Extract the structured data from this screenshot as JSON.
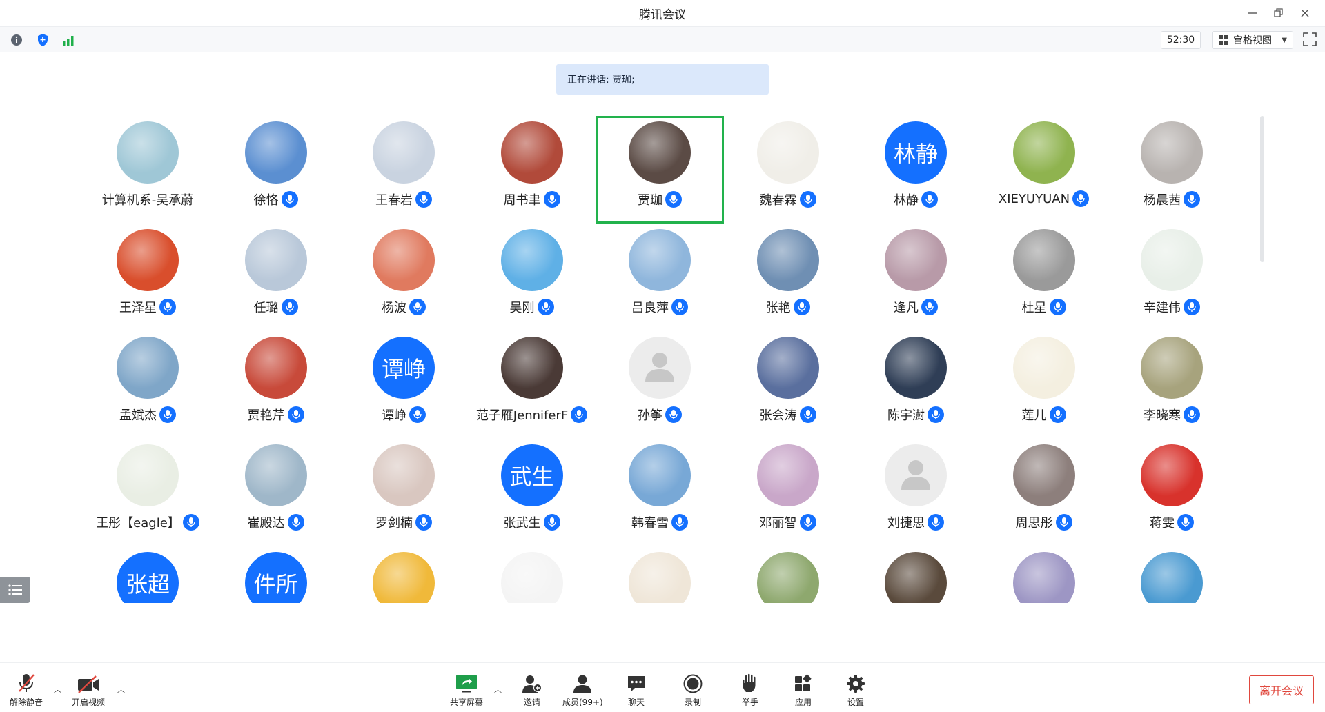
{
  "window": {
    "title": "腾讯会议"
  },
  "toolbar": {
    "timer": "52:30",
    "view_label": "宫格视图"
  },
  "speaking": {
    "text": "正在讲话: 贾珈;"
  },
  "colors": {
    "accent": "#1470ff",
    "active_border": "#22b24c",
    "leave": "#e0483e",
    "banner": "#dbe8fb"
  },
  "participants": [
    {
      "name": "计算机系-吴承蔚",
      "avatar": "photo",
      "mic": false
    },
    {
      "name": "徐恪",
      "avatar": "photo",
      "mic": true
    },
    {
      "name": "王春岩",
      "avatar": "photo",
      "mic": true
    },
    {
      "name": "周书聿",
      "avatar": "photo",
      "mic": true
    },
    {
      "name": "贾珈",
      "avatar": "photo",
      "mic": true,
      "active": true
    },
    {
      "name": "魏春霖",
      "avatar": "photo",
      "mic": true
    },
    {
      "name": "林静",
      "avatar": "text",
      "avatar_text": "林静",
      "mic": true
    },
    {
      "name": "XIEYUYUAN",
      "avatar": "photo",
      "mic": true
    },
    {
      "name": "杨晨茜",
      "avatar": "photo",
      "mic": true
    },
    {
      "name": "王泽星",
      "avatar": "photo",
      "mic": true
    },
    {
      "name": "任璐",
      "avatar": "photo",
      "mic": true
    },
    {
      "name": "杨波",
      "avatar": "photo",
      "mic": true
    },
    {
      "name": "吴刚",
      "avatar": "photo",
      "mic": true
    },
    {
      "name": "吕良萍",
      "avatar": "photo",
      "mic": true
    },
    {
      "name": "张艳",
      "avatar": "photo",
      "mic": true
    },
    {
      "name": "逄凡",
      "avatar": "photo",
      "mic": true
    },
    {
      "name": "杜星",
      "avatar": "photo",
      "mic": true
    },
    {
      "name": "辛建伟",
      "avatar": "photo",
      "mic": true
    },
    {
      "name": "孟斌杰",
      "avatar": "photo",
      "mic": true
    },
    {
      "name": "贾艳芹",
      "avatar": "photo",
      "mic": true
    },
    {
      "name": "谭峥",
      "avatar": "text",
      "avatar_text": "谭峥",
      "mic": true
    },
    {
      "name": "范子雁JenniferF",
      "avatar": "photo",
      "mic": true
    },
    {
      "name": "孙筝",
      "avatar": "default",
      "mic": true
    },
    {
      "name": "张会涛",
      "avatar": "photo",
      "mic": true
    },
    {
      "name": "陈宇澍",
      "avatar": "photo",
      "mic": true
    },
    {
      "name": "莲儿",
      "avatar": "photo",
      "mic": true
    },
    {
      "name": "李晓寒",
      "avatar": "photo",
      "mic": true
    },
    {
      "name": "王彤【eagle】",
      "avatar": "photo",
      "mic": true
    },
    {
      "name": "崔殿达",
      "avatar": "photo",
      "mic": true
    },
    {
      "name": "罗剑楠",
      "avatar": "photo",
      "mic": true
    },
    {
      "name": "张武生",
      "avatar": "text",
      "avatar_text": "武生",
      "mic": true
    },
    {
      "name": "韩春雪",
      "avatar": "photo",
      "mic": true
    },
    {
      "name": "邓丽智",
      "avatar": "photo",
      "mic": true
    },
    {
      "name": "刘捷思",
      "avatar": "default",
      "mic": true
    },
    {
      "name": "周思彤",
      "avatar": "photo",
      "mic": true
    },
    {
      "name": "蒋雯",
      "avatar": "photo",
      "mic": true
    },
    {
      "name": "",
      "avatar": "text",
      "avatar_text": "张超",
      "mic": false
    },
    {
      "name": "",
      "avatar": "text",
      "avatar_text": "件所",
      "mic": false
    },
    {
      "name": "",
      "avatar": "photo",
      "mic": false
    },
    {
      "name": "",
      "avatar": "photo",
      "mic": false
    },
    {
      "name": "",
      "avatar": "photo",
      "mic": false
    },
    {
      "name": "",
      "avatar": "photo",
      "mic": false
    },
    {
      "name": "",
      "avatar": "photo",
      "mic": false
    },
    {
      "name": "",
      "avatar": "photo",
      "mic": false
    },
    {
      "name": "",
      "avatar": "photo",
      "mic": false
    }
  ],
  "avatar_colors": [
    "#9fc7d6",
    "#5b8fd1",
    "#c9d3e0",
    "#b14a3a",
    "#5b4b45",
    "#f0eee8",
    "#1470ff",
    "#8fb34f",
    "#b8b3b0",
    "#d94e2c",
    "#b9c8d9",
    "#e07a5f",
    "#5fb0e6",
    "#8fb6dc",
    "#6f8fb3",
    "#b89aa8",
    "#9a9a9a",
    "#e8efe8",
    "#7fa6c8",
    "#c84a3a",
    "#1470ff",
    "#4a3a36",
    "#ececec",
    "#5a6f9e",
    "#2f3e56",
    "#f4efe0",
    "#a7a37d",
    "#e9eee4",
    "#9fb7c9",
    "#d9c7c0",
    "#1470ff",
    "#78a8d6",
    "#c9a7c9",
    "#ececec",
    "#8d7f7c",
    "#d8322c",
    "#1470ff",
    "#1470ff",
    "#f0b93a",
    "#f4f4f4",
    "#efe6d8",
    "#8ea86e",
    "#5a4a3c",
    "#9d96c4",
    "#4a9ad1"
  ],
  "bottombar": {
    "unmute": "解除静音",
    "video": "开启视频",
    "share": "共享屏幕",
    "invite": "邀请",
    "members": "成员(99+)",
    "chat": "聊天",
    "record": "录制",
    "raise_hand": "举手",
    "apps": "应用",
    "settings": "设置",
    "leave": "离开会议"
  }
}
